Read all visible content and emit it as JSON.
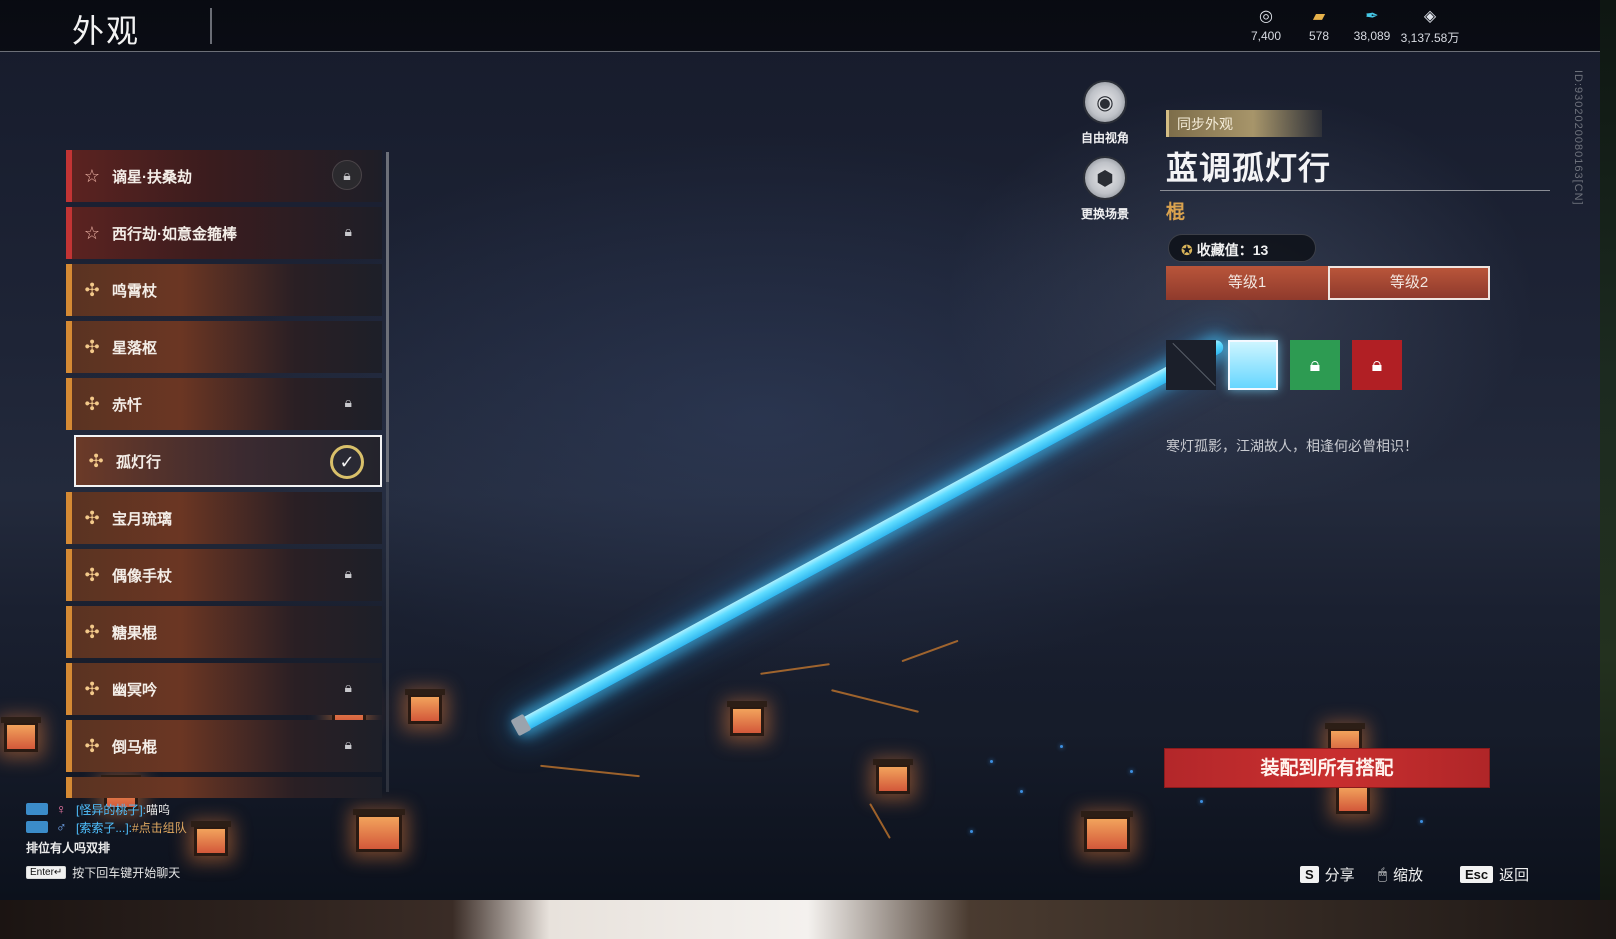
{
  "header": {
    "title": "外观",
    "currencies": [
      {
        "icon": "spiral-coin-icon",
        "glyph": "◎",
        "value": "7,400"
      },
      {
        "icon": "ticket-stack-icon",
        "glyph": "▰",
        "value": "578"
      },
      {
        "icon": "feather-icon",
        "glyph": "✒",
        "value": "38,089"
      },
      {
        "icon": "diamond-coin-icon",
        "glyph": "◈",
        "value": "3,137.58万"
      }
    ]
  },
  "list": {
    "items": [
      {
        "label": "谪星·扶桑劫",
        "rarity": "red",
        "locked": true,
        "lock_style": "circle"
      },
      {
        "label": "西行劫·如意金箍棒",
        "rarity": "red",
        "locked": true
      },
      {
        "label": "鸣霄杖",
        "rarity": "orange",
        "locked": false
      },
      {
        "label": "星落枢",
        "rarity": "orange",
        "locked": false
      },
      {
        "label": "赤忏",
        "rarity": "orange",
        "locked": true
      },
      {
        "label": "孤灯行",
        "rarity": "orange",
        "locked": false,
        "selected": true
      },
      {
        "label": "宝月琉璃",
        "rarity": "orange",
        "locked": false
      },
      {
        "label": "偶像手杖",
        "rarity": "orange",
        "locked": true
      },
      {
        "label": "糖果棍",
        "rarity": "orange",
        "locked": false
      },
      {
        "label": "幽冥吟",
        "rarity": "orange",
        "locked": true
      },
      {
        "label": "倒马棍",
        "rarity": "orange",
        "locked": true
      }
    ]
  },
  "camera": {
    "free_view": "自由视角",
    "change_scene": "更换场景"
  },
  "detail": {
    "sync_tag": "同步外观",
    "name": "蓝调孤灯行",
    "type": "棍",
    "collect_label": "收藏值：13",
    "tabs": [
      {
        "label": "等级1",
        "active": false
      },
      {
        "label": "等级2",
        "active": true
      }
    ],
    "swatches": [
      "none",
      "blue",
      "green-locked",
      "red-locked"
    ],
    "description": "寒灯孤影，江湖故人，相逢何必曾相识！",
    "equip_button": "装配到所有搭配"
  },
  "chat": {
    "lines": [
      {
        "gender": "♀",
        "who": "[怪异的桃子]:",
        "msg": "喵呜"
      },
      {
        "gender": "♂",
        "who": "[索索子...]:",
        "msg": "#点击组队"
      }
    ],
    "plain": "排位有人吗双排",
    "hint_key": "Enter↵",
    "hint": "按下回车键开始聊天"
  },
  "hotkeys": [
    {
      "key": "S",
      "label": "分享"
    },
    {
      "key": "🖱",
      "label": "缩放"
    },
    {
      "key": "Esc",
      "label": "返回"
    }
  ],
  "uid": "ID:9302020080163[CN]",
  "colors": {
    "rarity_red": "#c23434",
    "rarity_orange": "#d58a34",
    "staff_glow": "#5fdcff",
    "equip_red": "#c92f2f",
    "type_gold": "#d9a24e"
  }
}
